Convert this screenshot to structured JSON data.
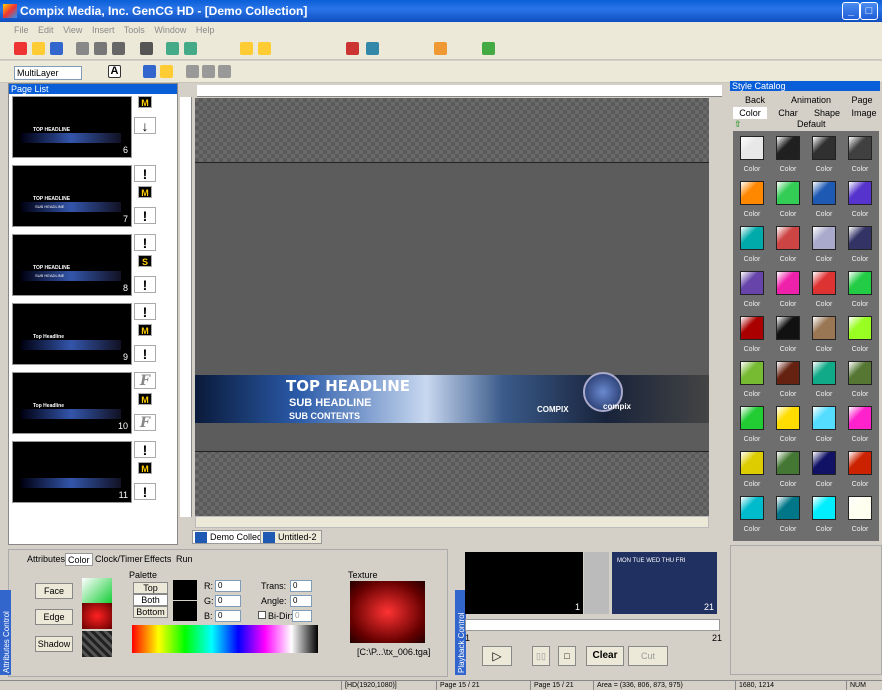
{
  "window": {
    "title": "Compix Media, Inc. GenCG HD - [Demo Collection]"
  },
  "menu": [
    "File",
    "Edit",
    "View",
    "Insert",
    "Tools",
    "Window",
    "Help"
  ],
  "toolbar": {
    "layer_mode": "MultiLayer"
  },
  "page_list": {
    "title": "Page List",
    "pages": [
      {
        "num": "6",
        "headline": "TOP HEADLINE",
        "badges": [
          "M",
          "↓"
        ]
      },
      {
        "num": "7",
        "headline": "TOP HEADLINE",
        "sub": "SUB HEADLINE",
        "badges": [
          "!",
          "M",
          "!"
        ]
      },
      {
        "num": "8",
        "headline": "TOP HEADLINE",
        "sub": "SUB HEADLINE",
        "badges": [
          "!",
          "S",
          "!"
        ]
      },
      {
        "num": "9",
        "headline": "Top Headline",
        "badges": [
          "!",
          "M",
          "!"
        ]
      },
      {
        "num": "10",
        "headline": "Top Headline",
        "badges": [
          "F",
          "M",
          "F"
        ]
      },
      {
        "num": "11",
        "headline": "",
        "badges": [
          "!",
          "M",
          "!"
        ]
      }
    ]
  },
  "canvas": {
    "top_headline": "TOP HEADLINE",
    "sub_headline": "SUB HEADLINE",
    "sub_contents": "SUB CONTENTS",
    "logo_text": "COMPIX",
    "badge_text": "compix"
  },
  "doc_tabs": [
    "Demo Collection",
    "Untitled-2"
  ],
  "style_catalog": {
    "title": "Style Catalog",
    "tabs_row1": [
      "Back",
      "Animation",
      "Page"
    ],
    "tabs_row2": [
      "Color",
      "Char",
      "Shape",
      "Image"
    ],
    "default_label": "Default",
    "swatch_label": "Color",
    "swatches": [
      "#e8e8e8",
      "#202020",
      "#303030",
      "#404040",
      "#ff8800",
      "#33cc55",
      "#1e5ab4",
      "#5533cc",
      "#00aaaa",
      "#cc4444",
      "#aaaacc",
      "#333366",
      "#6644aa",
      "#ee22aa",
      "#dd3333",
      "#22cc44",
      "#aa0000",
      "#111111",
      "#997755",
      "#99ff22",
      "#77bb33",
      "#662211",
      "#11aa88",
      "#557733",
      "#22cc33",
      "#ffdd00",
      "#55ddff",
      "#ff22cc",
      "#ddcc00",
      "#447733",
      "#111166",
      "#cc2200",
      "#00bbcc",
      "#007788",
      "#00eeff",
      "#fffff0"
    ]
  },
  "attributes": {
    "tabs": [
      "Attributes",
      "Color",
      "Clock/Timer",
      "Effects",
      "Run"
    ],
    "face": "Face",
    "edge": "Edge",
    "shadow": "Shadow",
    "palette_label": "Palette",
    "top": "Top",
    "both": "Both",
    "bottom": "Bottom",
    "r_label": "R:",
    "g_label": "G:",
    "b_label": "B:",
    "r": "0",
    "g": "0",
    "b": "0",
    "trans_label": "Trans:",
    "trans": "0",
    "angle_label": "Angle:",
    "angle": "0",
    "bidir_label": "Bi-Dir:",
    "bidir": "0",
    "texture_label": "Texture",
    "texture_file": "[C:\\P...\\tx_006.tga]",
    "side_label": "Attributes Control"
  },
  "playback": {
    "side_label": "Playback Control",
    "thumb1_num": "1",
    "thumb2_num": "21",
    "range_start": "1",
    "range_end": "21",
    "clear": "Clear",
    "cut": "Cut",
    "weekdays": "MON TUE WED THU FRI"
  },
  "status": {
    "format": "[HD(1920,1080)]",
    "page1": "Page 15 / 21",
    "page2": "Page 15 / 21",
    "area": "Area = (336, 806, 873, 975)",
    "res": "1680, 1214",
    "num": "NUM"
  }
}
